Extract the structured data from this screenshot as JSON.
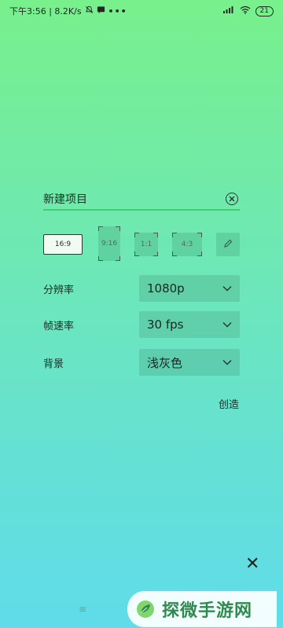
{
  "status_bar": {
    "time_text": "下午3:56 | 8.2K/s",
    "dots": "•••",
    "signal": "HD",
    "wifi": "wifi",
    "battery": "21"
  },
  "project": {
    "name_value": "新建项目",
    "clear_icon": "clear-circle-icon"
  },
  "aspect_ratios": [
    {
      "label": "16:9",
      "selected": true
    },
    {
      "label": "9:16",
      "selected": false
    },
    {
      "label": "1:1",
      "selected": false
    },
    {
      "label": "4:3",
      "selected": false
    },
    {
      "label": "",
      "icon": "edit-pencil-icon",
      "selected": false
    }
  ],
  "settings": {
    "resolution": {
      "label": "分辨率",
      "value": "1080p"
    },
    "frame_rate": {
      "label": "帧速率",
      "value": "30 fps"
    },
    "background": {
      "label": "背景",
      "value": "浅灰色"
    }
  },
  "actions": {
    "create_label": "创造",
    "close_icon": "close-icon",
    "close_glyph": "✕"
  },
  "nav": {
    "menu_glyph": "≡"
  },
  "watermark": {
    "text": "探微手游网"
  },
  "colors": {
    "accent_underline": "#3fcf6e",
    "gradient_top": "#78f08c",
    "gradient_bottom": "#60dcea"
  }
}
